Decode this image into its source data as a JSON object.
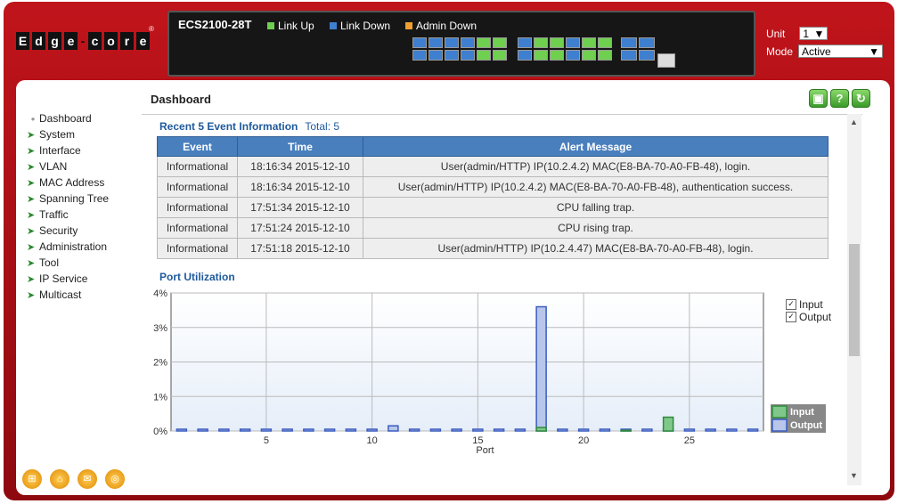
{
  "header": {
    "model": "ECS2100-28T",
    "legend": [
      {
        "label": "Link Up",
        "color": "#6fcf4f"
      },
      {
        "label": "Link Down",
        "color": "#3f7fcf"
      },
      {
        "label": "Admin Down",
        "color": "#f0a030"
      }
    ],
    "unit_label": "Unit",
    "unit_value": "1",
    "mode_label": "Mode",
    "mode_value": "Active"
  },
  "sidebar": {
    "items": [
      {
        "label": "Dashboard",
        "icon": "dot-icon"
      },
      {
        "label": "System",
        "icon": "arrow-icon"
      },
      {
        "label": "Interface",
        "icon": "arrow-icon"
      },
      {
        "label": "VLAN",
        "icon": "arrow-icon"
      },
      {
        "label": "MAC Address",
        "icon": "arrow-icon"
      },
      {
        "label": "Spanning Tree",
        "icon": "arrow-icon"
      },
      {
        "label": "Traffic",
        "icon": "arrow-icon"
      },
      {
        "label": "Security",
        "icon": "arrow-icon"
      },
      {
        "label": "Administration",
        "icon": "arrow-icon"
      },
      {
        "label": "Tool",
        "icon": "arrow-icon"
      },
      {
        "label": "IP Service",
        "icon": "arrow-icon"
      },
      {
        "label": "Multicast",
        "icon": "arrow-icon"
      }
    ]
  },
  "page": {
    "title": "Dashboard",
    "toolbar": {
      "save": "save-icon",
      "help": "?",
      "refresh": "↻"
    }
  },
  "events": {
    "title": "Recent 5 Event Information",
    "total": "Total: 5",
    "headers": [
      "Event",
      "Time",
      "Alert Message"
    ],
    "rows": [
      [
        "Informational",
        "18:16:34 2015-12-10",
        "User(admin/HTTP) IP(10.2.4.2) MAC(E8-BA-70-A0-FB-48), login."
      ],
      [
        "Informational",
        "18:16:34 2015-12-10",
        "User(admin/HTTP) IP(10.2.4.2) MAC(E8-BA-70-A0-FB-48), authentication success."
      ],
      [
        "Informational",
        "17:51:34 2015-12-10",
        "CPU falling trap."
      ],
      [
        "Informational",
        "17:51:24 2015-12-10",
        "CPU rising trap."
      ],
      [
        "Informational",
        "17:51:18 2015-12-10",
        "User(admin/HTTP) IP(10.2.4.47) MAC(E8-BA-70-A0-FB-48), login."
      ]
    ]
  },
  "port_util": {
    "title": "Port Utilization",
    "checkbox_input": "Input",
    "checkbox_output": "Output"
  },
  "chart_data": {
    "type": "bar",
    "title": "Port Utilization",
    "xlabel": "Port",
    "ylabel": "",
    "ylim": [
      0,
      4
    ],
    "y_ticks": [
      "0%",
      "1%",
      "2%",
      "3%",
      "4%"
    ],
    "x_ticks": [
      5,
      10,
      15,
      20,
      25
    ],
    "categories": [
      1,
      2,
      3,
      4,
      5,
      6,
      7,
      8,
      9,
      10,
      11,
      12,
      13,
      14,
      15,
      16,
      17,
      18,
      19,
      20,
      21,
      22,
      23,
      24,
      25,
      26,
      27,
      28
    ],
    "series": [
      {
        "name": "Input",
        "color": "#2e8b3a",
        "values": [
          0,
          0,
          0,
          0,
          0,
          0,
          0,
          0,
          0,
          0,
          0,
          0,
          0,
          0,
          0,
          0,
          0,
          0.1,
          0,
          0,
          0,
          0.02,
          0,
          0.4,
          0,
          0,
          0,
          0
        ]
      },
      {
        "name": "Output",
        "color": "#3a5cc0",
        "values": [
          0,
          0,
          0,
          0,
          0,
          0,
          0,
          0,
          0,
          0,
          0.15,
          0,
          0,
          0,
          0,
          0,
          0,
          3.6,
          0,
          0,
          0,
          0,
          0,
          0,
          0,
          0,
          0,
          0
        ]
      }
    ],
    "legend_position": "bottom-right"
  }
}
